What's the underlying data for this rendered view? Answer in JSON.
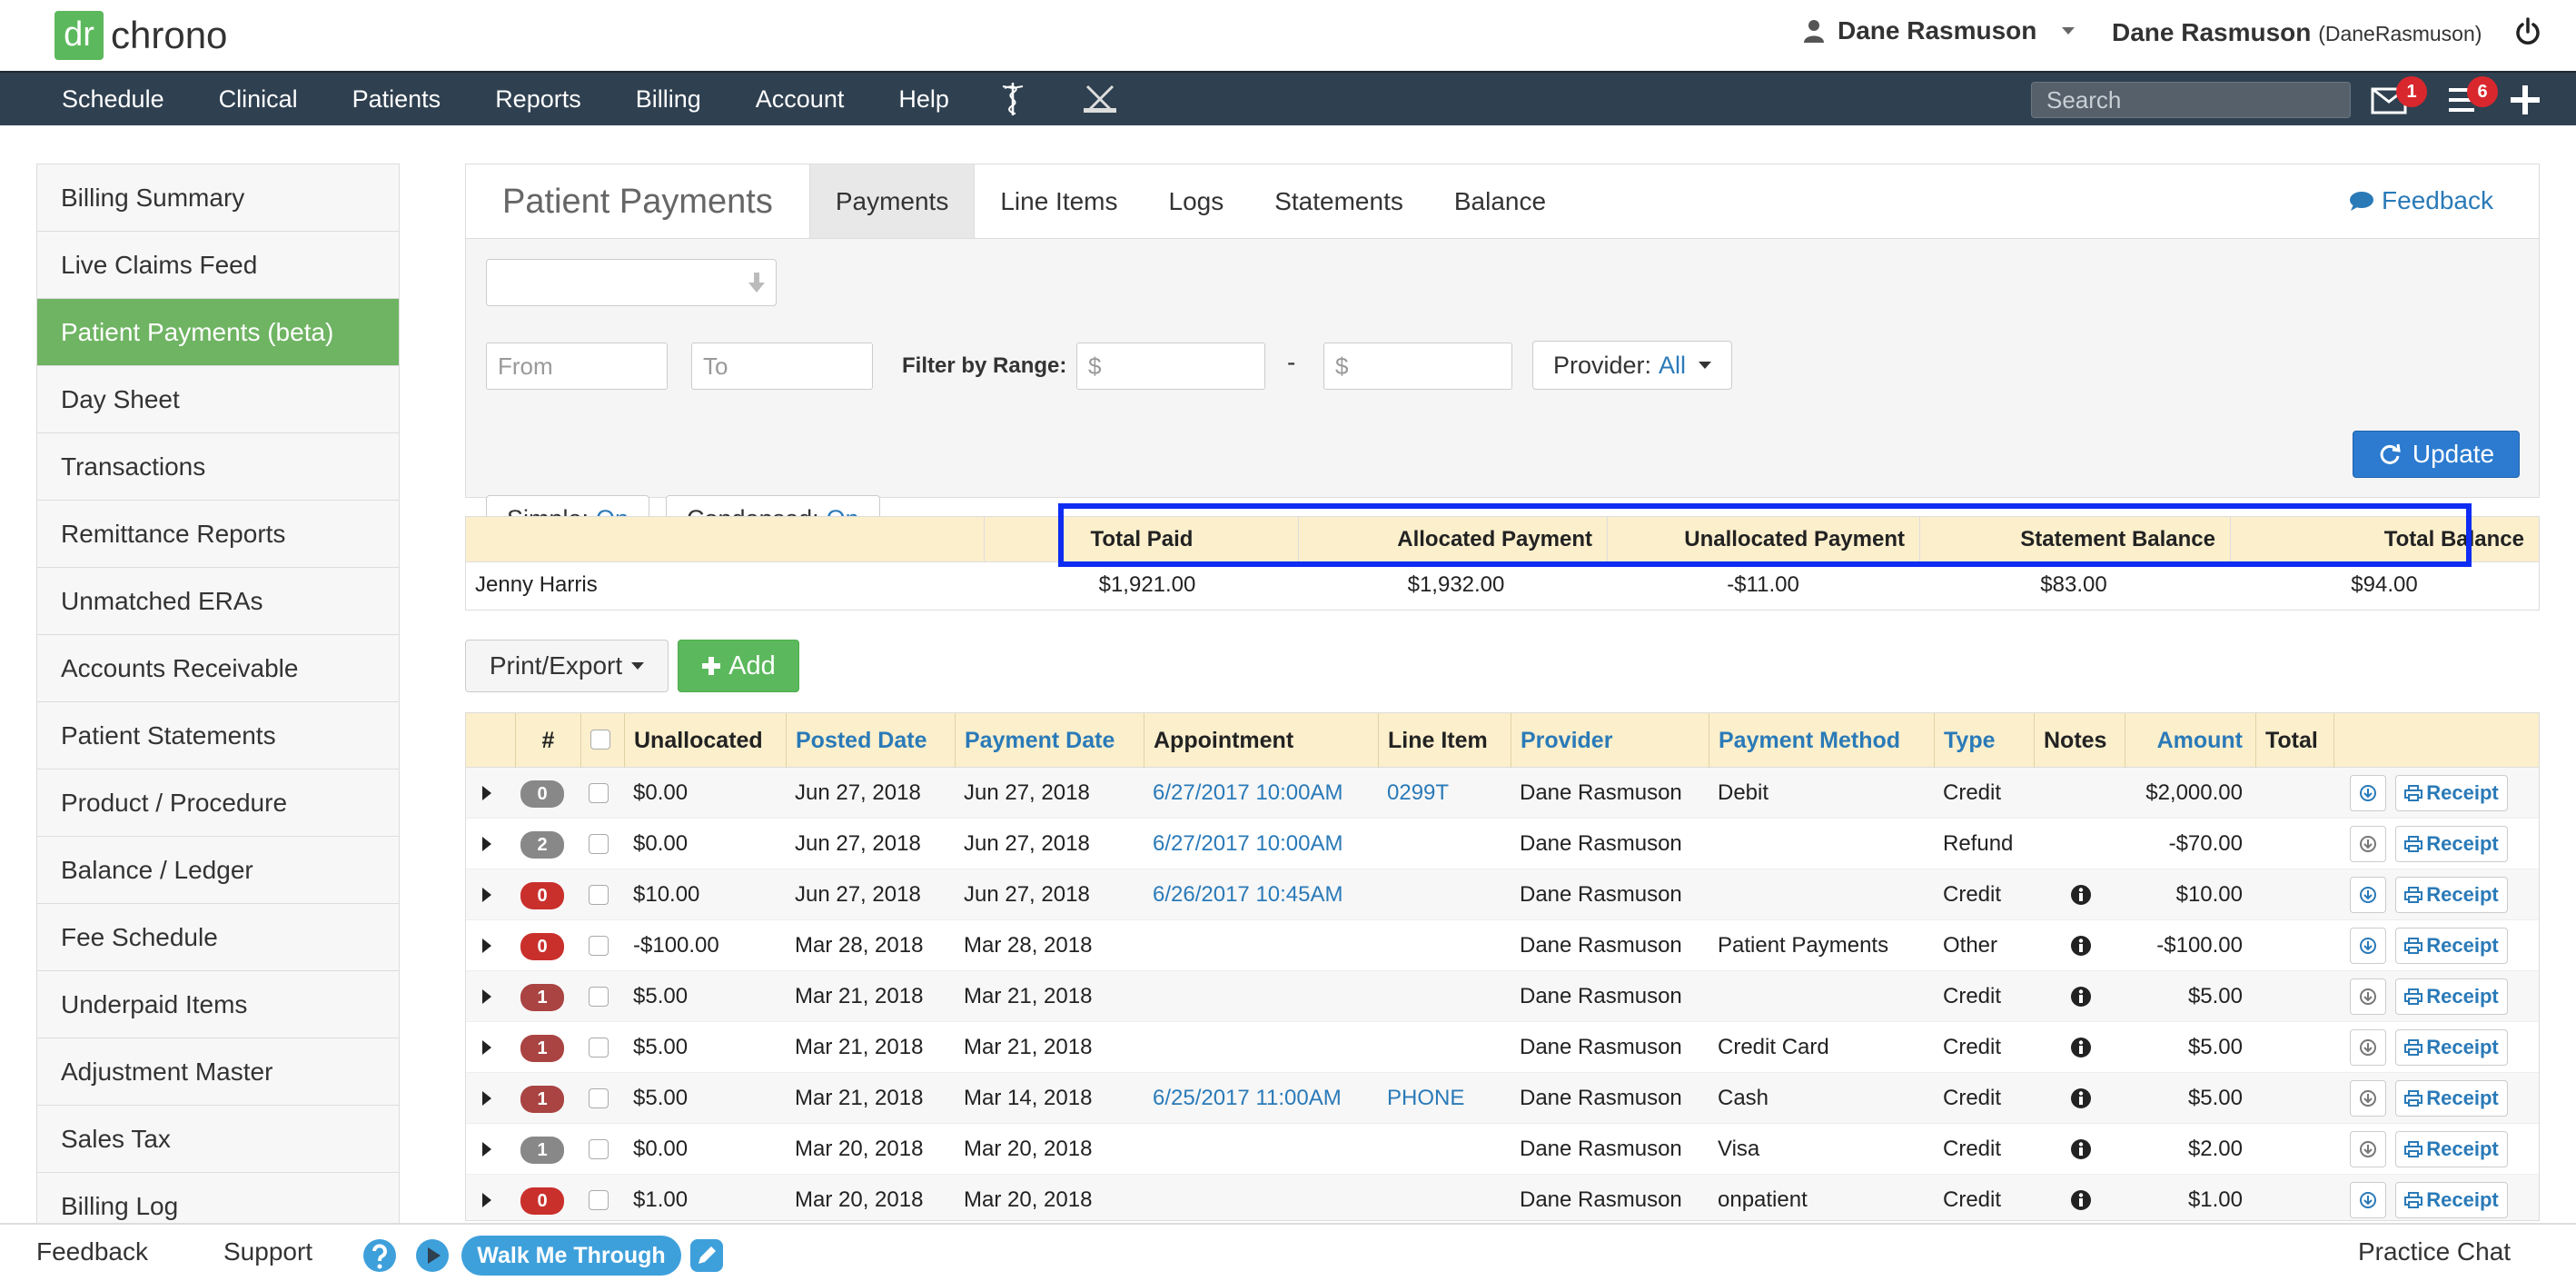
{
  "header": {
    "logo_box": "dr",
    "logo_text": "chrono",
    "user_menu_label": "Dane Rasmuson",
    "user_full_name": "Dane Rasmuson",
    "user_handle": "(DaneRasmuson)"
  },
  "nav": {
    "items": [
      "Schedule",
      "Clinical",
      "Patients",
      "Reports",
      "Billing",
      "Account",
      "Help"
    ],
    "search_placeholder": "Search",
    "mail_badge": "1",
    "tasks_badge": "6"
  },
  "sidebar": {
    "items": [
      "Billing Summary",
      "Live Claims Feed",
      "Patient Payments (beta)",
      "Day Sheet",
      "Transactions",
      "Remittance Reports",
      "Unmatched ERAs",
      "Accounts Receivable",
      "Patient Statements",
      "Product / Procedure",
      "Balance / Ledger",
      "Fee Schedule",
      "Underpaid Items",
      "Adjustment Master",
      "Sales Tax",
      "Billing Log"
    ],
    "active_index": 2
  },
  "panel": {
    "title": "Patient Payments",
    "tabs": [
      "Payments",
      "Line Items",
      "Logs",
      "Statements",
      "Balance"
    ],
    "active_tab": "Payments",
    "feedback_label": "Feedback"
  },
  "filters": {
    "from_placeholder": "From",
    "to_placeholder": "To",
    "range_label": "Filter by Range:",
    "min_placeholder": "$",
    "max_placeholder": "$",
    "range_separator": "-",
    "provider_label": "Provider:",
    "provider_value": "All",
    "simple_label": "Simple:",
    "simple_value": "On",
    "condensed_label": "Condensed:",
    "condensed_value": "On",
    "update_label": "Update"
  },
  "summary": {
    "headers": [
      "Total Paid",
      "Allocated Payment",
      "Unallocated Payment",
      "Statement Balance",
      "Total Balance"
    ],
    "patient": "Jenny Harris",
    "values": [
      "$1,921.00",
      "$1,932.00",
      "-$11.00",
      "$83.00",
      "$94.00"
    ]
  },
  "toolbar": {
    "print_label": "Print/Export",
    "add_label": "Add"
  },
  "grid": {
    "headers": {
      "num": "#",
      "unallocated": "Unallocated",
      "posted_date": "Posted Date",
      "payment_date": "Payment Date",
      "appointment": "Appointment",
      "line_item": "Line Item",
      "provider": "Provider",
      "payment_method": "Payment Method",
      "type": "Type",
      "notes": "Notes",
      "amount": "Amount",
      "total": "Total"
    },
    "receipt_label": "Receipt",
    "rows": [
      {
        "count": "0",
        "count_color": "#888888",
        "unallocated": "$0.00",
        "posted": "Jun 27, 2018",
        "paid": "Jun 27, 2018",
        "appointment": "6/27/2017 10:00AM",
        "line_item": "0299T",
        "provider": "Dane Rasmuson",
        "method": "Debit",
        "type": "Credit",
        "has_note": false,
        "amount": "$2,000.00",
        "allocate_active": true
      },
      {
        "count": "2",
        "count_color": "#888888",
        "unallocated": "$0.00",
        "posted": "Jun 27, 2018",
        "paid": "Jun 27, 2018",
        "appointment": "6/27/2017 10:00AM",
        "line_item": "",
        "provider": "Dane Rasmuson",
        "method": "",
        "type": "Refund",
        "has_note": false,
        "amount": "-$70.00",
        "allocate_active": false
      },
      {
        "count": "0",
        "count_color": "#c9302c",
        "unallocated": "$10.00",
        "posted": "Jun 27, 2018",
        "paid": "Jun 27, 2018",
        "appointment": "6/26/2017 10:45AM",
        "line_item": "",
        "provider": "Dane Rasmuson",
        "method": "",
        "type": "Credit",
        "has_note": true,
        "amount": "$10.00",
        "allocate_active": true
      },
      {
        "count": "0",
        "count_color": "#c9302c",
        "unallocated": "-$100.00",
        "posted": "Mar 28, 2018",
        "paid": "Mar 28, 2018",
        "appointment": "",
        "line_item": "",
        "provider": "Dane Rasmuson",
        "method": "Patient Payments",
        "type": "Other",
        "has_note": true,
        "amount": "-$100.00",
        "allocate_active": true
      },
      {
        "count": "1",
        "count_color": "#a94442",
        "unallocated": "$5.00",
        "posted": "Mar 21, 2018",
        "paid": "Mar 21, 2018",
        "appointment": "",
        "line_item": "",
        "provider": "Dane Rasmuson",
        "method": "",
        "type": "Credit",
        "has_note": true,
        "amount": "$5.00",
        "allocate_active": false
      },
      {
        "count": "1",
        "count_color": "#a94442",
        "unallocated": "$5.00",
        "posted": "Mar 21, 2018",
        "paid": "Mar 21, 2018",
        "appointment": "",
        "line_item": "",
        "provider": "Dane Rasmuson",
        "method": "Credit Card",
        "type": "Credit",
        "has_note": true,
        "amount": "$5.00",
        "allocate_active": false
      },
      {
        "count": "1",
        "count_color": "#a94442",
        "unallocated": "$5.00",
        "posted": "Mar 21, 2018",
        "paid": "Mar 14, 2018",
        "appointment": "6/25/2017 11:00AM",
        "line_item": "PHONE",
        "provider": "Dane Rasmuson",
        "method": "Cash",
        "type": "Credit",
        "has_note": true,
        "amount": "$5.00",
        "allocate_active": false
      },
      {
        "count": "1",
        "count_color": "#888888",
        "unallocated": "$0.00",
        "posted": "Mar 20, 2018",
        "paid": "Mar 20, 2018",
        "appointment": "",
        "line_item": "",
        "provider": "Dane Rasmuson",
        "method": "Visa",
        "type": "Credit",
        "has_note": true,
        "amount": "$2.00",
        "allocate_active": false
      },
      {
        "count": "0",
        "count_color": "#c9302c",
        "unallocated": "$1.00",
        "posted": "Mar 20, 2018",
        "paid": "Mar 20, 2018",
        "appointment": "",
        "line_item": "",
        "provider": "Dane Rasmuson",
        "method": "onpatient",
        "type": "Credit",
        "has_note": true,
        "amount": "$1.00",
        "allocate_active": true
      }
    ]
  },
  "footer": {
    "feedback_label": "Feedback",
    "support_label": "Support",
    "walk_label": "Walk Me Through",
    "chat_label": "Practice Chat"
  },
  "colors": {
    "nav_bg": "#2f4050",
    "sidebar_active": "#6fb463",
    "table_header": "#fcefcc",
    "link": "#2a7ab8",
    "highlight_border": "#0f2cf3"
  }
}
